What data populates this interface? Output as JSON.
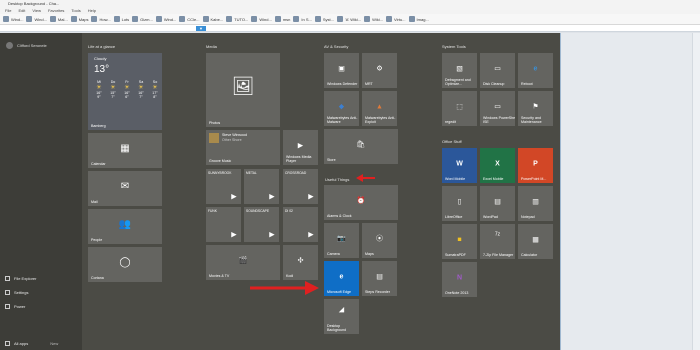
{
  "browser": {
    "title": "Desktop Background - Cha...",
    "menus": [
      "File",
      "Edit",
      "View",
      "Favorites",
      "Tools",
      "Help"
    ],
    "bookmarks": [
      "Wind...",
      "Wind...",
      "Mal...",
      "Maps",
      "How...",
      "Lots",
      "Gizm...",
      "Wind...",
      "CCle...",
      "Kabe...",
      "TUTO...",
      "Wind...",
      "msn",
      "In S...",
      "Syst...",
      "'A'  Wiki...",
      "Wiki...",
      "Virtu...",
      "Imag..."
    ],
    "scroll_tab": "▼"
  },
  "start_menu": {
    "user_name": "Clifford Seronele",
    "rail_items": [
      {
        "label": "File Explorer",
        "icon": "folder-icon"
      },
      {
        "label": "Settings",
        "icon": "gear-icon"
      },
      {
        "label": "Power",
        "icon": "power-icon"
      },
      {
        "label": "All apps",
        "icon": "apps-icon"
      }
    ],
    "all_apps_suffix": "New",
    "groups": {
      "life": "Life at a glance",
      "media": "Media",
      "av": "AV & Security",
      "sys": "System Tools",
      "office": "Office Stuff",
      "useful": "Useful Things"
    },
    "weather": {
      "city": "Cloudy",
      "temp": "13°",
      "location": "Bamberg",
      "days": [
        {
          "d": "Mi",
          "hi": "16°",
          "lo": "9°"
        },
        {
          "d": "Do",
          "hi": "15°",
          "lo": "7°"
        },
        {
          "d": "Fr",
          "hi": "16°",
          "lo": "6°"
        },
        {
          "d": "Sa",
          "hi": "16°",
          "lo": "7°"
        },
        {
          "d": "So",
          "hi": "17°",
          "lo": "8°"
        }
      ]
    },
    "tiles": {
      "calendar": "Calendar",
      "mail": "Mail",
      "people": "People",
      "cortana": "Cortana",
      "photos": "Photos",
      "groove": "Groove Music",
      "groove_song": "Steve Winwood",
      "groove_artist": "Other Shore",
      "wmp": "Windows Media Player",
      "movies": "Movies & TV",
      "kodi": "Kodi",
      "s1": "SUNNYBROOK",
      "s2": "METAL",
      "s3": "CROSSROAD",
      "s4": "FUNK",
      "s5": "SOUNDSCAPE",
      "s6": "DI 02",
      "defender": "Windows Defender",
      "mrt": "MRT",
      "mbam": "Malwarebytes Anti-Malware",
      "mbae": "Malwarebytes Anti-Exploit",
      "store": "Store",
      "alarms": "Alarms & Clock",
      "camera": "Camera",
      "maps": "Maps",
      "edge": "Microsoft Edge",
      "steps": "Steps Recorder",
      "desktop_bg": "Desktop Background",
      "defrag": "Defragment and Optimize...",
      "cleanup": "Disk Cleanup",
      "reboot": "Reboot",
      "regedit": "regedit",
      "ps": "Windows PowerShell ISE",
      "security": "Security and Maintenance",
      "word": "Word Mobile",
      "excel": "Excel Mobile",
      "ppt": "PowerPoint M...",
      "libre": "LibreOffice",
      "wordpad": "WordPad",
      "notepad": "Notepad",
      "sumatra": "SumatraPDF",
      "zip": "7-Zip File Manager",
      "calc": "Calculator",
      "onenote": "OneNote 2013"
    }
  }
}
